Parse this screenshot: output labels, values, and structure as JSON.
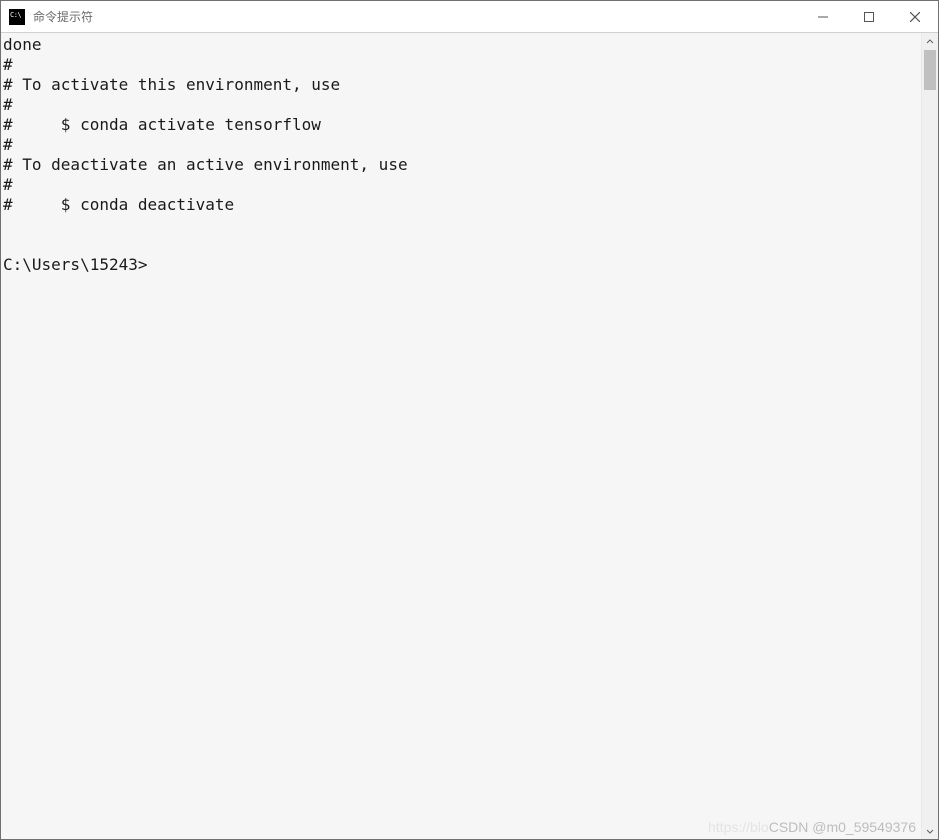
{
  "window": {
    "title": "命令提示符"
  },
  "terminal": {
    "lines": [
      "done",
      "#",
      "# To activate this environment, use",
      "#",
      "#     $ conda activate tensorflow",
      "#",
      "# To deactivate an active environment, use",
      "#",
      "#     $ conda deactivate",
      "",
      "",
      "C:\\Users\\15243>"
    ]
  },
  "watermark": {
    "faint": "https://blo",
    "text": "CSDN @m0_59549376"
  }
}
